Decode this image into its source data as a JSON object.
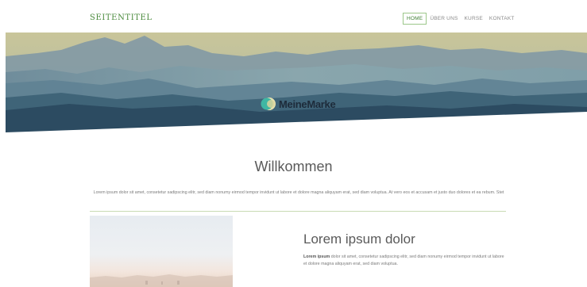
{
  "header": {
    "site_title": "SEITENTITEL",
    "nav": [
      {
        "label": "HOME",
        "active": true
      },
      {
        "label": "ÜBER UNS",
        "active": false
      },
      {
        "label": "KURSE",
        "active": false
      },
      {
        "label": "KONTAKT",
        "active": false
      }
    ]
  },
  "hero": {
    "brand_name": "MeineMarke",
    "logo_icon": "circle-logo-icon"
  },
  "welcome": {
    "title": "Willkommen",
    "text": "Lorem ipsum dolor sit amet, consetetur sadipscing elitr, sed diam nonumy eirmod tempor invidunt ut labore et dolore magna aliquyam erat, sed diam voluptua. At vero eos et accusam et justo duo dolores et ea rebum. Stet"
  },
  "section": {
    "title": "Lorem ipsum dolor",
    "text_bold": "Lorem ipsum",
    "text_rest": " dolor sit amet, consetetur sadipscing elitr, sed diam nonumy eirmod tempor invidunt ut labore et dolore magna aliquyam erat, sed diam voluptua."
  },
  "colors": {
    "accent_green": "#4a8a3c",
    "nav_active_border": "#9cc78a",
    "divider": "#c9dbb4",
    "brand_text": "#1d2b3a"
  }
}
